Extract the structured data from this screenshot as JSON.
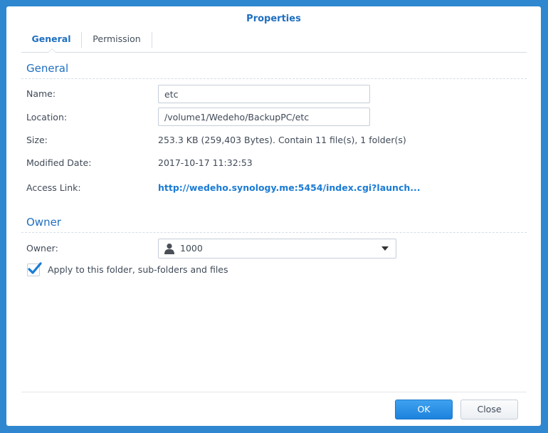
{
  "dialog": {
    "title": "Properties"
  },
  "tabs": [
    {
      "label": "General",
      "active": true
    },
    {
      "label": "Permission",
      "active": false
    }
  ],
  "general": {
    "section_title": "General",
    "name_label": "Name:",
    "name_value": "etc",
    "location_label": "Location:",
    "location_value": "/volume1/Wedeho/BackupPC/etc",
    "size_label": "Size:",
    "size_value": "253.3 KB (259,403 Bytes). Contain 11 file(s), 1 folder(s)",
    "modified_label": "Modified Date:",
    "modified_value": "2017-10-17 11:32:53",
    "access_label": "Access Link:",
    "access_value": "http://wedeho.synology.me:5454/index.cgi?launch..."
  },
  "owner": {
    "section_title": "Owner",
    "owner_label": "Owner:",
    "owner_value": "1000",
    "owner_icon": "user-icon",
    "apply_checked": true,
    "apply_label": "Apply to this folder, sub-folders and files"
  },
  "footer": {
    "ok_label": "OK",
    "close_label": "Close"
  },
  "colors": {
    "accent": "#1f6fbf",
    "link": "#1a7bd4",
    "primary_button": "#1c82dd",
    "backdrop": "#2f87cf"
  }
}
